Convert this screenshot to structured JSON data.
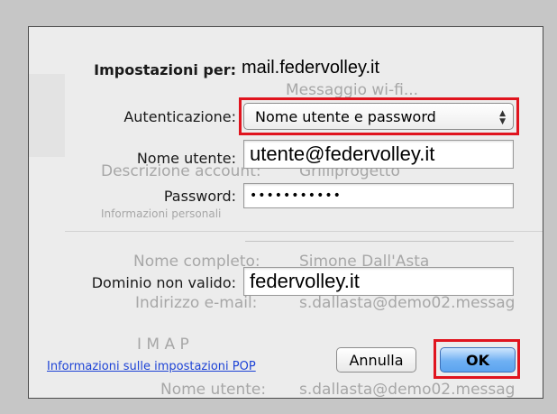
{
  "background_text": {
    "message_header": "Messaggio wi-fi...",
    "account_description_label": "Descrizione account:",
    "account_description_value": "Grilliprogetto",
    "personal_info_label": "Informazioni personali",
    "full_name_label": "Nome completo:",
    "full_name_value": "Simone Dall'Asta",
    "email_label": "Indirizzo e-mail:",
    "email_value": "s.dallasta@demo02.messag",
    "incoming_label": "I  M  A  P",
    "username_label": "Nome utente:",
    "username_value": "s.dallasta@demo02.messag"
  },
  "dialog": {
    "settings_for_label": "Impostazioni per:",
    "settings_for_value": "mail.federvolley.it",
    "authentication": {
      "label": "Autenticazione:",
      "selected": "Nome utente e password"
    },
    "username": {
      "label": "Nome utente:",
      "value": "utente@federvolley.it"
    },
    "password": {
      "label": "Password:",
      "value": "•••••••••••"
    },
    "invalid_domain": {
      "label": "Dominio non valido:",
      "value": "federvolley.it"
    },
    "help_link": "Informazioni sulle impostazioni POP",
    "cancel_label": "Annulla",
    "ok_label": "OK"
  },
  "colors": {
    "highlight": "#e0141e",
    "link": "#1d43d6",
    "default_button": "#6fb0f3"
  }
}
